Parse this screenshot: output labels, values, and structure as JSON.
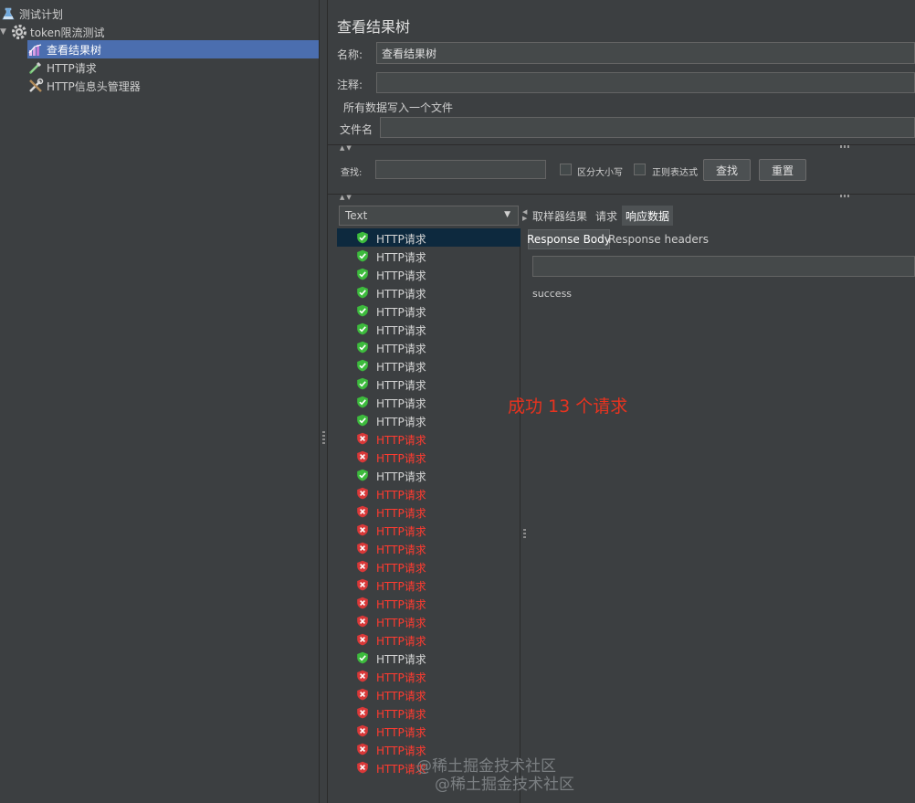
{
  "tree": {
    "items": [
      {
        "label": "测试计划",
        "icon": "test-plan-icon"
      },
      {
        "label": "token限流测试",
        "icon": "thread-group-gear-icon"
      },
      {
        "label": "查看结果树",
        "icon": "listener-chart-icon"
      },
      {
        "label": "HTTP请求",
        "icon": "pipette-sampler-icon"
      },
      {
        "label": "HTTP信息头管理器",
        "icon": "wrench-tools-icon"
      }
    ]
  },
  "panel": {
    "title": "查看结果树",
    "name_label": "名称:",
    "name_value": "查看结果树",
    "comment_label": "注释:",
    "comment_value": "",
    "write_all_label": "所有数据写入一个文件",
    "filename_label": "文件名",
    "filename_value": ""
  },
  "search": {
    "label": "查找:",
    "value": "",
    "case_label": "区分大小写",
    "regex_label": "正则表达式",
    "find_button": "查找",
    "reset_button": "重置"
  },
  "renderer": {
    "selected": "Text"
  },
  "results": {
    "selected_index": 0,
    "items": [
      {
        "label": "HTTP请求",
        "status": "success"
      },
      {
        "label": "HTTP请求",
        "status": "success"
      },
      {
        "label": "HTTP请求",
        "status": "success"
      },
      {
        "label": "HTTP请求",
        "status": "success"
      },
      {
        "label": "HTTP请求",
        "status": "success"
      },
      {
        "label": "HTTP请求",
        "status": "success"
      },
      {
        "label": "HTTP请求",
        "status": "success"
      },
      {
        "label": "HTTP请求",
        "status": "success"
      },
      {
        "label": "HTTP请求",
        "status": "success"
      },
      {
        "label": "HTTP请求",
        "status": "success"
      },
      {
        "label": "HTTP请求",
        "status": "success"
      },
      {
        "label": "HTTP请求",
        "status": "fail"
      },
      {
        "label": "HTTP请求",
        "status": "fail"
      },
      {
        "label": "HTTP请求",
        "status": "success"
      },
      {
        "label": "HTTP请求",
        "status": "fail"
      },
      {
        "label": "HTTP请求",
        "status": "fail"
      },
      {
        "label": "HTTP请求",
        "status": "fail"
      },
      {
        "label": "HTTP请求",
        "status": "fail"
      },
      {
        "label": "HTTP请求",
        "status": "fail"
      },
      {
        "label": "HTTP请求",
        "status": "fail"
      },
      {
        "label": "HTTP请求",
        "status": "fail"
      },
      {
        "label": "HTTP请求",
        "status": "fail"
      },
      {
        "label": "HTTP请求",
        "status": "fail"
      },
      {
        "label": "HTTP请求",
        "status": "success"
      },
      {
        "label": "HTTP请求",
        "status": "fail"
      },
      {
        "label": "HTTP请求",
        "status": "fail"
      },
      {
        "label": "HTTP请求",
        "status": "fail"
      },
      {
        "label": "HTTP请求",
        "status": "fail"
      },
      {
        "label": "HTTP请求",
        "status": "fail"
      },
      {
        "label": "HTTP请求",
        "status": "fail"
      }
    ]
  },
  "detail_tabs": {
    "items": [
      "取样器结果",
      "请求",
      "响应数据"
    ],
    "active": 2
  },
  "response_tabs": {
    "items": [
      "Response Body",
      "Response headers"
    ],
    "active": 0
  },
  "response": {
    "search_value": "",
    "body": "success"
  },
  "annotation": "成功 13 个请求",
  "watermark": [
    "@稀土掘金技术社区",
    "@稀土掘金技术社区"
  ],
  "colors": {
    "background": "#3c3f41",
    "tree_selected": "#4b6eaf",
    "result_selected": "#0d293e",
    "success_icon": "#3dbb3d",
    "fail_icon": "#d93838",
    "fail_text": "#ff3b30",
    "annotation": "#e8331f"
  }
}
